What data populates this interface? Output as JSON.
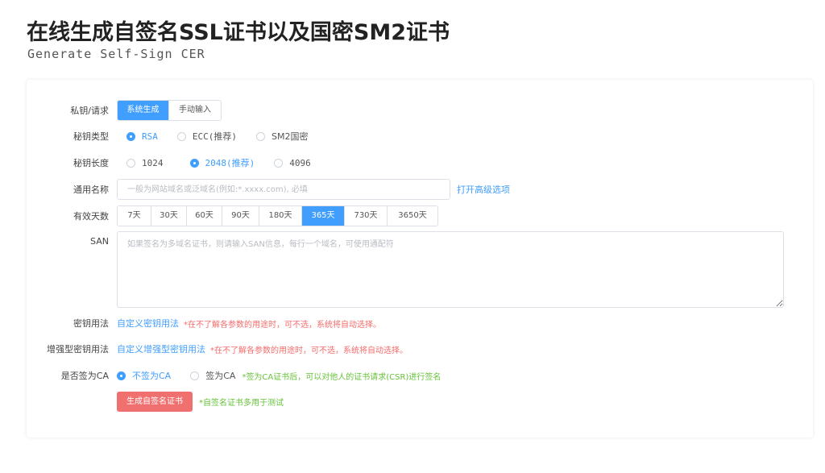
{
  "header": {
    "title": "在线生成自签名SSL证书以及国密SM2证书",
    "subtitle": "Generate Self-Sign CER"
  },
  "form": {
    "key_request": {
      "label": "私钥/请求",
      "options": [
        "系统生成",
        "手动输入"
      ],
      "selected": "系统生成"
    },
    "key_type": {
      "label": "秘钥类型",
      "options": [
        "RSA",
        "ECC(推荐)",
        "SM2国密"
      ],
      "selected": "RSA"
    },
    "key_length": {
      "label": "秘钥长度",
      "options": [
        "1024",
        "2048(推荐)",
        "4096"
      ],
      "selected": "2048(推荐)"
    },
    "common_name": {
      "label": "通用名称",
      "placeholder": "一般为网站域名或泛域名(例如:*.xxxx.com), 必填",
      "value": "",
      "advanced_link": "打开高级选项"
    },
    "validity": {
      "label": "有效天数",
      "options": [
        "7天",
        "30天",
        "60天",
        "90天",
        "180天",
        "365天",
        "730天",
        "3650天"
      ],
      "selected": "365天"
    },
    "san": {
      "label": "SAN",
      "placeholder": "如果签名为多域名证书，则请输入SAN信息，每行一个域名，可使用通配符",
      "value": ""
    },
    "key_usage": {
      "label": "密钥用法",
      "link": "自定义密钥用法",
      "note": "*在不了解各参数的用途时，可不选，系统将自动选择。"
    },
    "ext_key_usage": {
      "label": "增强型密钥用法",
      "link": "自定义增强型密钥用法",
      "note": "*在不了解各参数的用途时，可不选，系统将自动选择。"
    },
    "is_ca": {
      "label": "是否签为CA",
      "options": [
        "不签为CA",
        "签为CA"
      ],
      "selected": "不签为CA",
      "note": "*签为CA证书后，可以对他人的证书请求(CSR)进行签名"
    },
    "submit": {
      "label": "生成自签名证书",
      "note": "*自签名证书多用于测试"
    }
  },
  "colors": {
    "primary": "#409eff",
    "danger": "#f56c6c",
    "success": "#67c23a",
    "submit_button": "#f07070"
  }
}
